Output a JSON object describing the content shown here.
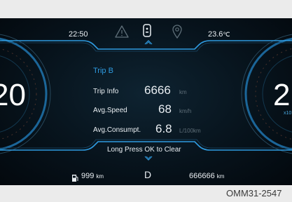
{
  "status": {
    "time": "22:50",
    "temperature": "23.6",
    "temperature_unit": "℃"
  },
  "trip": {
    "title": "Trip B",
    "rows": [
      {
        "label": "Trip Info",
        "value": "6666",
        "unit": "km"
      },
      {
        "label": "Avg.Speed",
        "value": "68",
        "unit": "km/h"
      },
      {
        "label": "Avg.Consumpt.",
        "value": "6.8",
        "unit": "L/100km"
      }
    ],
    "hint": "Long Press OK to Clear"
  },
  "bottom": {
    "range_value": "999",
    "range_unit": "km",
    "gear": "D",
    "odometer_value": "666666",
    "odometer_unit": "km"
  },
  "gauges": {
    "left_digit": "20",
    "right_digit": "2",
    "right_sub": "x10"
  },
  "caption": "OMM31-2547",
  "colors": {
    "accent_blue": "#2f9be0",
    "dim_icon": "#5f6f79",
    "text": "#e9eef2",
    "background_outer": "#ebebeb"
  },
  "icons": [
    "warning-triangle-icon",
    "phone-icon",
    "location-pin-icon",
    "fuel-pump-icon",
    "chevron-up-icon",
    "chevron-down-icon"
  ]
}
